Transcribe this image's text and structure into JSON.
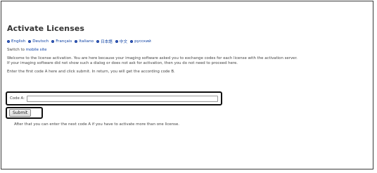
{
  "page": {
    "title": "Activate Licenses",
    "languages": [
      {
        "label": "English",
        "icon": "bullet-icon"
      },
      {
        "label": "Deutsch",
        "icon": "bullet-icon"
      },
      {
        "label": "Français",
        "icon": "bullet-icon"
      },
      {
        "label": "Italiano",
        "icon": "bullet-icon"
      },
      {
        "label": "日本語",
        "icon": "bullet-icon"
      },
      {
        "label": "中文",
        "icon": "bullet-icon"
      },
      {
        "label": "русский",
        "icon": "bullet-icon"
      }
    ],
    "switch_prefix": "Switch to",
    "switch_link": "mobile site",
    "welcome_line1": "Welcome to the license activation. You are here because your imaging software asked you to exchange codes for each license with the activation server.",
    "welcome_line2": "If your imaging software did not show such a dialog or does not ask for activation, then you do not need to proceed here.",
    "enter_text": "Enter the first code A here and click submit. In return, you will get the according code B."
  },
  "form": {
    "code_a_label": "Code A:",
    "code_a_value": "",
    "code_a_placeholder": "",
    "submit_label": "Submit",
    "after_text": "After that you can enter the next code A if you have to activate more than one license."
  },
  "colors": {
    "link": "#0a3fa3",
    "bullet": "#3b63c7",
    "heading": "#333333",
    "highlight_border": "#111111"
  }
}
